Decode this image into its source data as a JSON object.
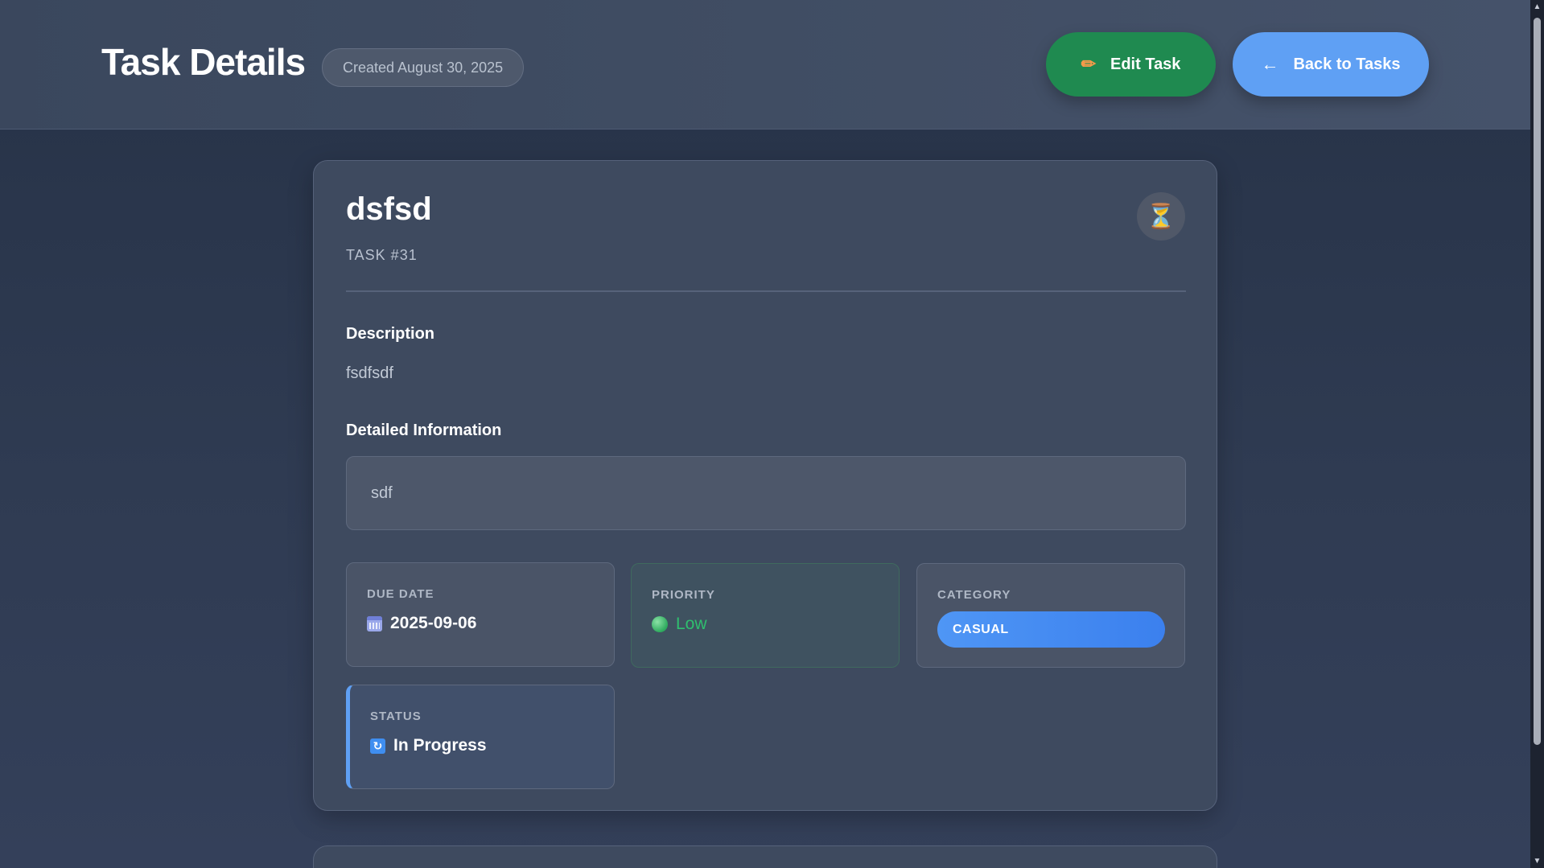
{
  "header": {
    "title": "Task Details",
    "created": "Created August 30, 2025",
    "edit_label": "Edit Task",
    "edit_icon": "✏",
    "back_label": "Back to Tasks",
    "back_icon": "←"
  },
  "task": {
    "title": "dsfsd",
    "number": "TASK #31",
    "status_icon": "⏳",
    "description_heading": "Description",
    "description": "fsdfsdf",
    "detail_heading": "Detailed Information",
    "detail": "sdf"
  },
  "info": {
    "due_label": "DUE DATE",
    "due_value": "2025-09-06",
    "priority_label": "PRIORITY",
    "priority_value": "Low",
    "category_label": "CATEGORY",
    "category_value": "CASUAL",
    "status_label": "STATUS",
    "status_value": "In Progress",
    "status_icon": "↻"
  },
  "scrollbar": {
    "up": "▲",
    "down": "▼"
  },
  "colors": {
    "edit_button": "#1f8a50",
    "back_button": "#5fa0f4",
    "priority_low": "#2fbf6e",
    "category_pill": "#3b80ee"
  }
}
